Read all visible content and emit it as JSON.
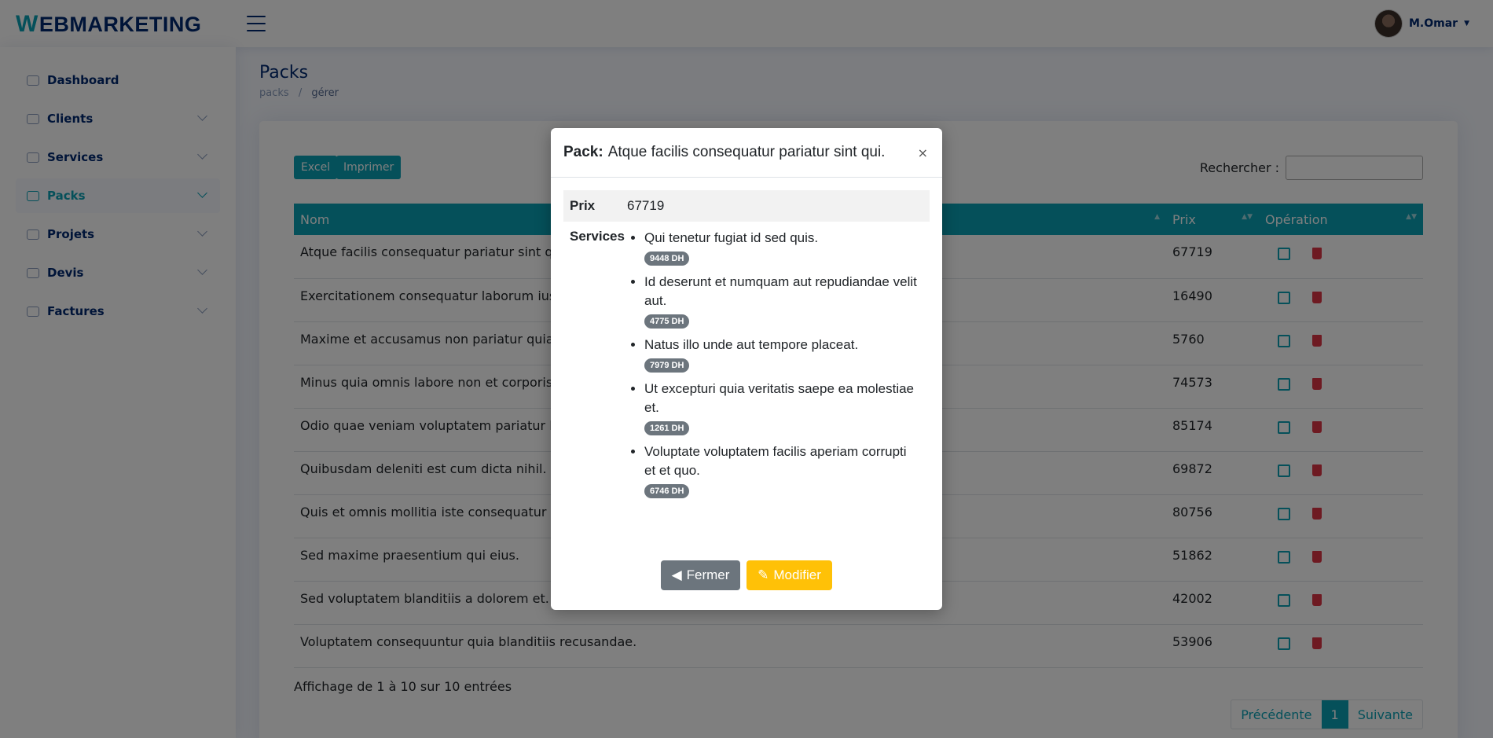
{
  "app": {
    "logo_initial": "W",
    "logo_rest": "EBMARKETING"
  },
  "user": {
    "name": "M.Omar"
  },
  "sidebar": {
    "items": [
      {
        "label": "Dashboard",
        "icon": "dashboard-icon"
      },
      {
        "label": "Clients",
        "icon": "people-icon"
      },
      {
        "label": "Services",
        "icon": "grid-icon"
      },
      {
        "label": "Packs",
        "icon": "box-icon"
      },
      {
        "label": "Projets",
        "icon": "project-icon"
      },
      {
        "label": "Devis",
        "icon": "document-icon"
      },
      {
        "label": "Factures",
        "icon": "invoice-icon"
      }
    ]
  },
  "page": {
    "title": "Packs",
    "breadcrumb": [
      "packs",
      "gérer"
    ]
  },
  "toolbar": {
    "excel": "Excel",
    "print": "Imprimer",
    "search_label": "Rechercher :",
    "search_value": ""
  },
  "table": {
    "headers": [
      "Nom",
      "Prix",
      "Opération"
    ],
    "rows": [
      {
        "name": "Atque facilis consequatur pariatur sint qui.",
        "price": "67719"
      },
      {
        "name": "Exercitationem consequatur laborum iusto",
        "price": "16490"
      },
      {
        "name": "Maxime et accusamus non pariatur quia pa",
        "price": "5760"
      },
      {
        "name": "Minus quia omnis labore non et corporis.",
        "price": "74573"
      },
      {
        "name": "Odio quae veniam voluptatem pariatur labo",
        "price": "85174"
      },
      {
        "name": "Quibusdam deleniti est cum dicta nihil.",
        "price": "69872"
      },
      {
        "name": "Quis et omnis mollitia iste consequatur nih",
        "price": "80756"
      },
      {
        "name": "Sed maxime praesentium qui eius.",
        "price": "51862"
      },
      {
        "name": "Sed voluptatem blanditiis a dolorem et.",
        "price": "42002"
      },
      {
        "name": "Voluptatem consequuntur quia blanditiis recusandae.",
        "price": "53906"
      }
    ]
  },
  "footer": {
    "info": "Affichage de 1 à 10 sur 10 entrées",
    "prev": "Précédente",
    "page": "1",
    "next": "Suivante"
  },
  "modal": {
    "title_label": "Pack:",
    "title_value": "Atque facilis consequatur pariatur sint qui.",
    "close_symbol": "×",
    "prix_label": "Prix",
    "prix_value": "67719",
    "services_label": "Services",
    "services": [
      {
        "name": "Qui tenetur fugiat id sed quis.",
        "price": "9448 DH"
      },
      {
        "name": "Id deserunt et numquam aut repudiandae velit aut.",
        "price": "4775 DH"
      },
      {
        "name": "Natus illo unde aut tempore placeat.",
        "price": "7979 DH"
      },
      {
        "name": "Ut excepturi quia veritatis saepe ea molestiae et.",
        "price": "1261 DH"
      },
      {
        "name": "Voluptate voluptatem facilis aperiam corrupti et et quo.",
        "price": "6746 DH"
      }
    ],
    "btn_close": "Fermer",
    "btn_edit": "Modifier"
  },
  "colors": {
    "accent": "#0aa1b5",
    "navy": "#012970",
    "danger": "#dc3545",
    "warning": "#ffc107",
    "secondary": "#6c757d"
  }
}
